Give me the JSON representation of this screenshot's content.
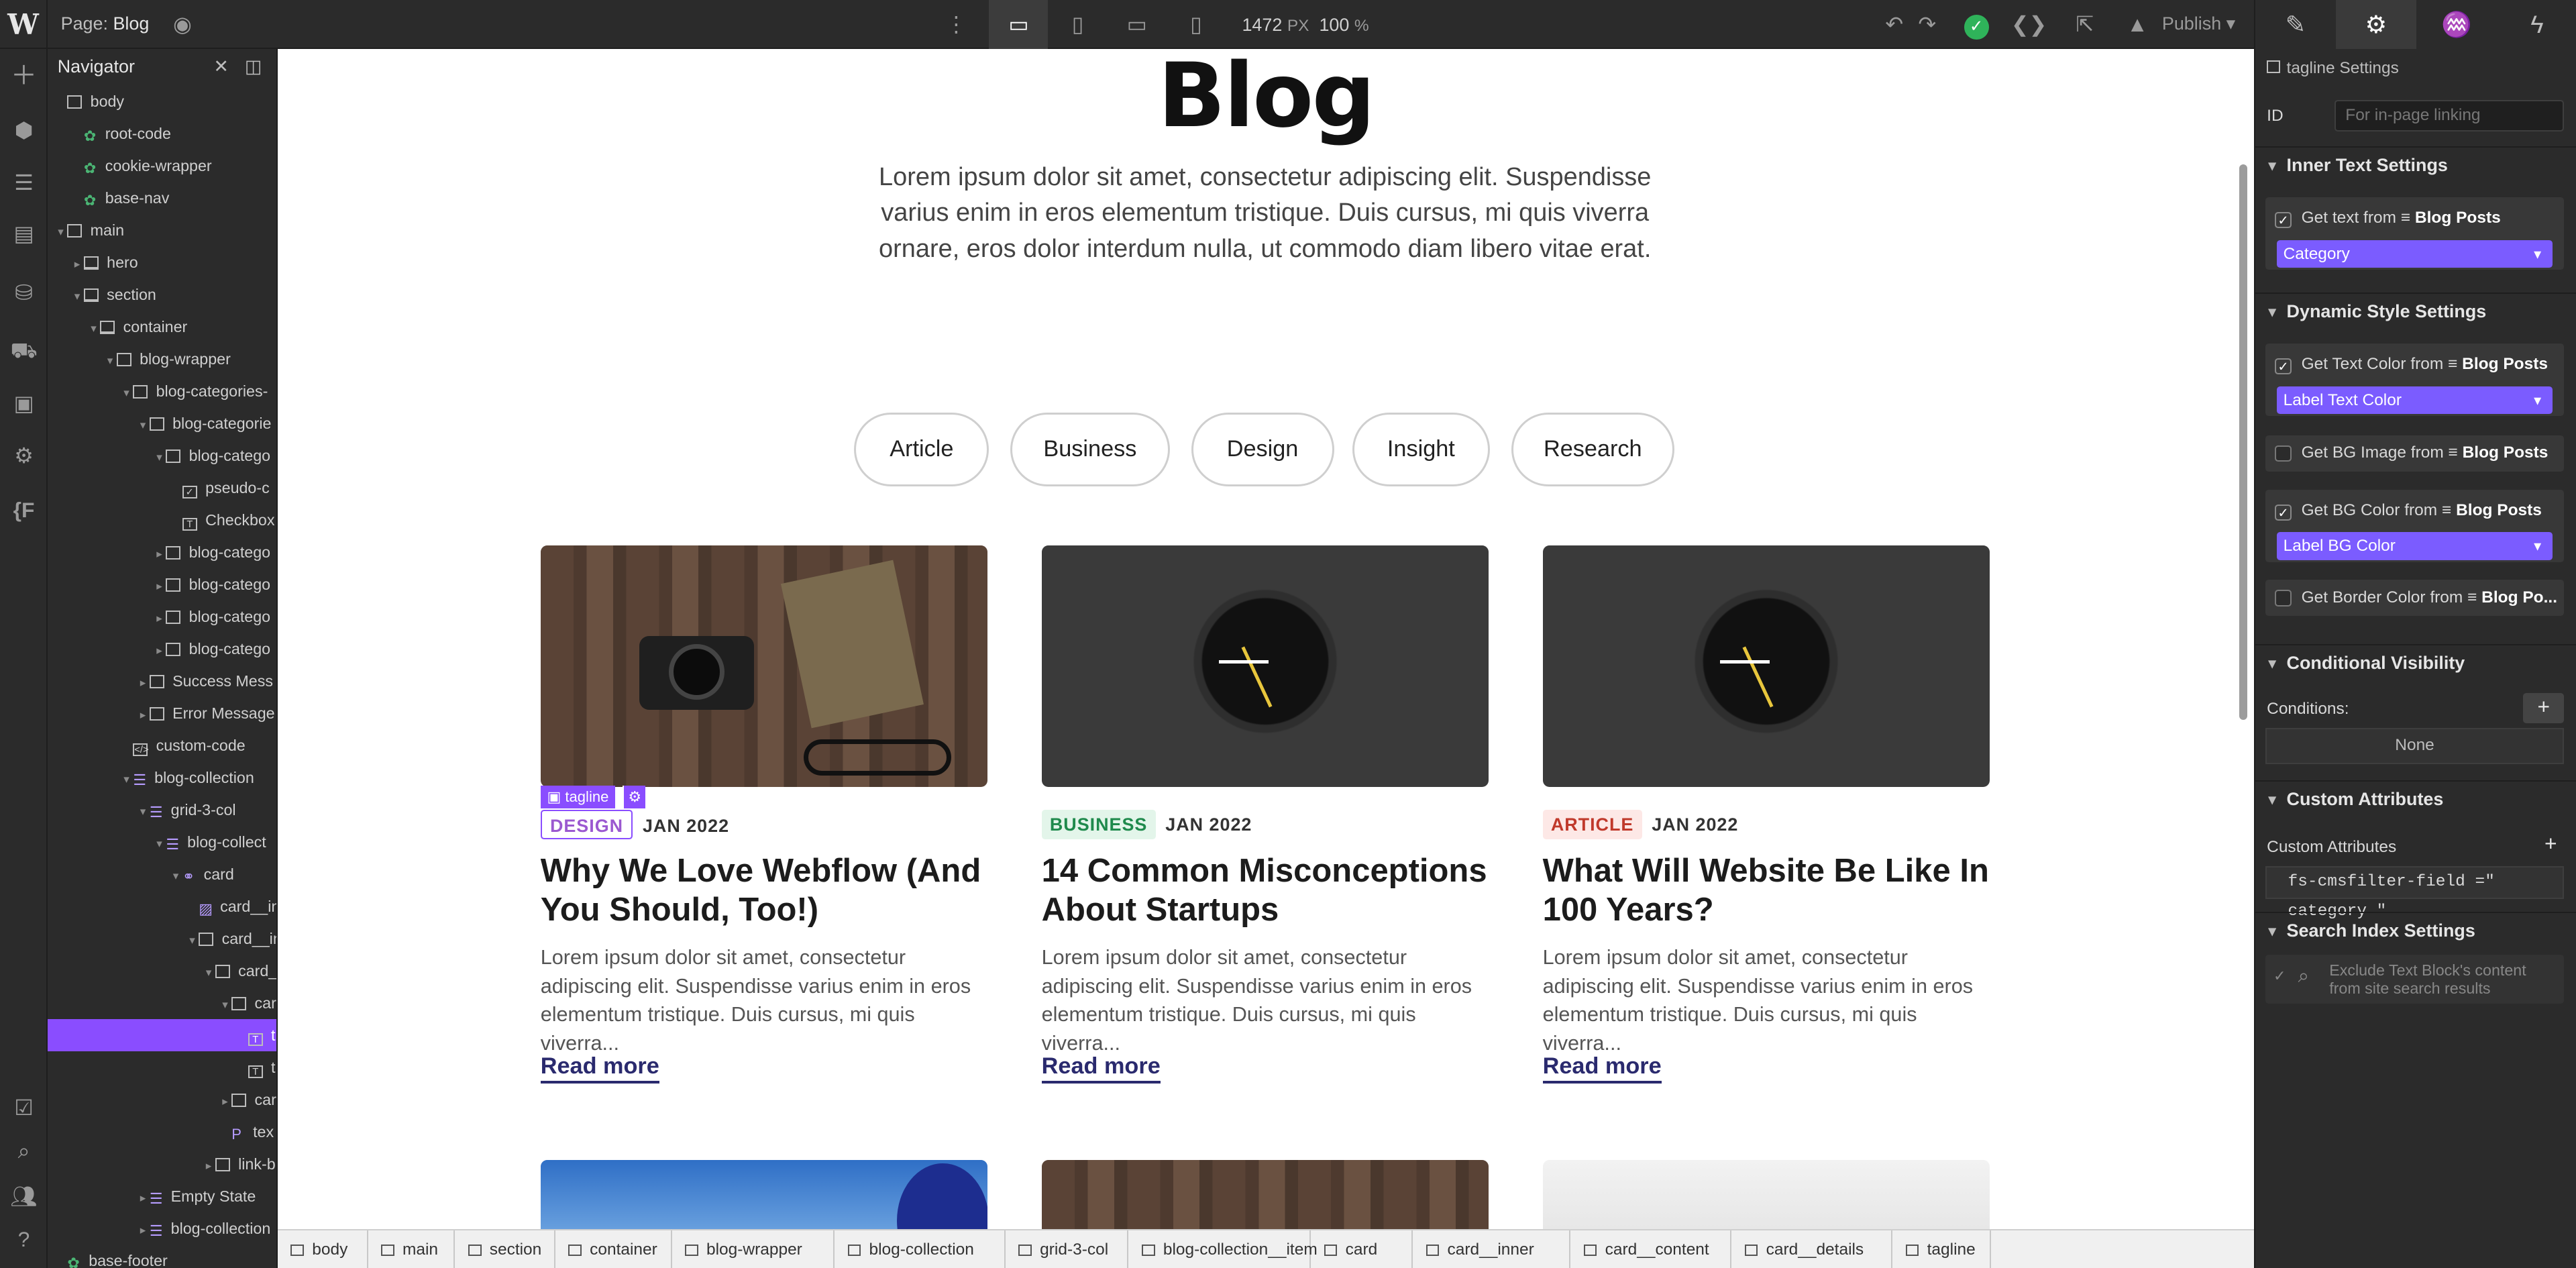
{
  "topbar": {
    "logo": "W",
    "page_prefix": "Page:",
    "page_name": "Blog",
    "width_value": "1472",
    "width_unit": "PX",
    "zoom_value": "100",
    "zoom_unit": "%",
    "publish_label": "Publish"
  },
  "navigator": {
    "title": "Navigator",
    "items": [
      {
        "label": "body"
      },
      {
        "label": "root-code"
      },
      {
        "label": "cookie-wrapper"
      },
      {
        "label": "base-nav"
      },
      {
        "label": "main"
      },
      {
        "label": "hero"
      },
      {
        "label": "section"
      },
      {
        "label": "container"
      },
      {
        "label": "blog-wrapper"
      },
      {
        "label": "blog-categories-"
      },
      {
        "label": "blog-categorie"
      },
      {
        "label": "blog-catego"
      },
      {
        "label": "pseudo-c"
      },
      {
        "label": "Checkbox"
      },
      {
        "label": "blog-catego"
      },
      {
        "label": "blog-catego"
      },
      {
        "label": "blog-catego"
      },
      {
        "label": "blog-catego"
      },
      {
        "label": "Success Mess"
      },
      {
        "label": "Error Message"
      },
      {
        "label": "custom-code"
      },
      {
        "label": "blog-collection"
      },
      {
        "label": "grid-3-col"
      },
      {
        "label": "blog-collect"
      },
      {
        "label": "card"
      },
      {
        "label": "card__in"
      },
      {
        "label": "card__in"
      },
      {
        "label": "card_"
      },
      {
        "label": "car"
      },
      {
        "label": "t"
      },
      {
        "label": "t"
      },
      {
        "label": "car"
      },
      {
        "label": "tex"
      },
      {
        "label": "link-b"
      },
      {
        "label": "Empty State"
      },
      {
        "label": "blog-collection"
      },
      {
        "label": "base-footer"
      }
    ]
  },
  "page": {
    "title": "Blog",
    "intro": "Lorem ipsum dolor sit amet, consectetur adipiscing elit. Suspendisse varius enim in eros elementum tristique. Duis cursus, mi quis viverra ornare, eros dolor interdum nulla, ut commodo diam libero vitae erat.",
    "categories": [
      "Article",
      "Business",
      "Design",
      "Insight",
      "Research"
    ],
    "cards": [
      {
        "tag": "DESIGN",
        "tag_color": "#9b59d0",
        "tag_bg": "#ffffff",
        "date": "JAN 2022",
        "title": "Why We Love Webflow (And You Should, Too!)",
        "desc": "Lorem ipsum dolor sit amet, consectetur adipiscing elit. Suspendisse varius enim in eros elementum tristique. Duis cursus, mi quis viverra...",
        "more": "Read more"
      },
      {
        "tag": "BUSINESS",
        "tag_color": "#1f8a4c",
        "tag_bg": "#e3f5ea",
        "date": "JAN 2022",
        "title": "14 Common Misconceptions About Startups",
        "desc": "Lorem ipsum dolor sit amet, consectetur adipiscing elit. Suspendisse varius enim in eros elementum tristique. Duis cursus, mi quis viverra...",
        "more": "Read more"
      },
      {
        "tag": "ARTICLE",
        "tag_color": "#c0392b",
        "tag_bg": "#fde8e6",
        "date": "JAN 2022",
        "title": "What Will Website Be Like In 100 Years?",
        "desc": "Lorem ipsum dolor sit amet, consectetur adipiscing elit. Suspendisse varius enim in eros elementum tristique. Duis cursus, mi quis viverra...",
        "more": "Read more"
      }
    ],
    "selected_label": "tagline"
  },
  "breadcrumbs": [
    "body",
    "main",
    "section",
    "container",
    "blog-wrapper",
    "blog-collection",
    "grid-3-col",
    "blog-collection__item",
    "card",
    "card__inner",
    "card__content",
    "card__details",
    "tagline"
  ],
  "settings": {
    "header": "tagline Settings",
    "id_label": "ID",
    "id_placeholder": "For in-page linking",
    "inner_text_title": "Inner Text Settings",
    "get_text_from": "Get text from",
    "blog_posts": "Blog Posts",
    "category_select": "Category",
    "dynamic_title": "Dynamic Style Settings",
    "get_text_color": "Get Text Color from",
    "label_text_color": "Label Text Color",
    "get_bg_image": "Get BG Image from",
    "get_bg_color": "Get BG Color from",
    "label_bg_color": "Label BG Color",
    "get_border_color": "Get Border Color from",
    "blog_po_trunc": "Blog Po...",
    "conditional_title": "Conditional Visibility",
    "conditions_label": "Conditions:",
    "conditions_value": "None",
    "custom_attr_title": "Custom Attributes",
    "custom_attr_label": "Custom Attributes",
    "custom_attr_value": "fs-cmsfilter-field =\" category \"",
    "search_index_title": "Search Index Settings",
    "search_index_text": "Exclude Text Block's content from site search results"
  }
}
